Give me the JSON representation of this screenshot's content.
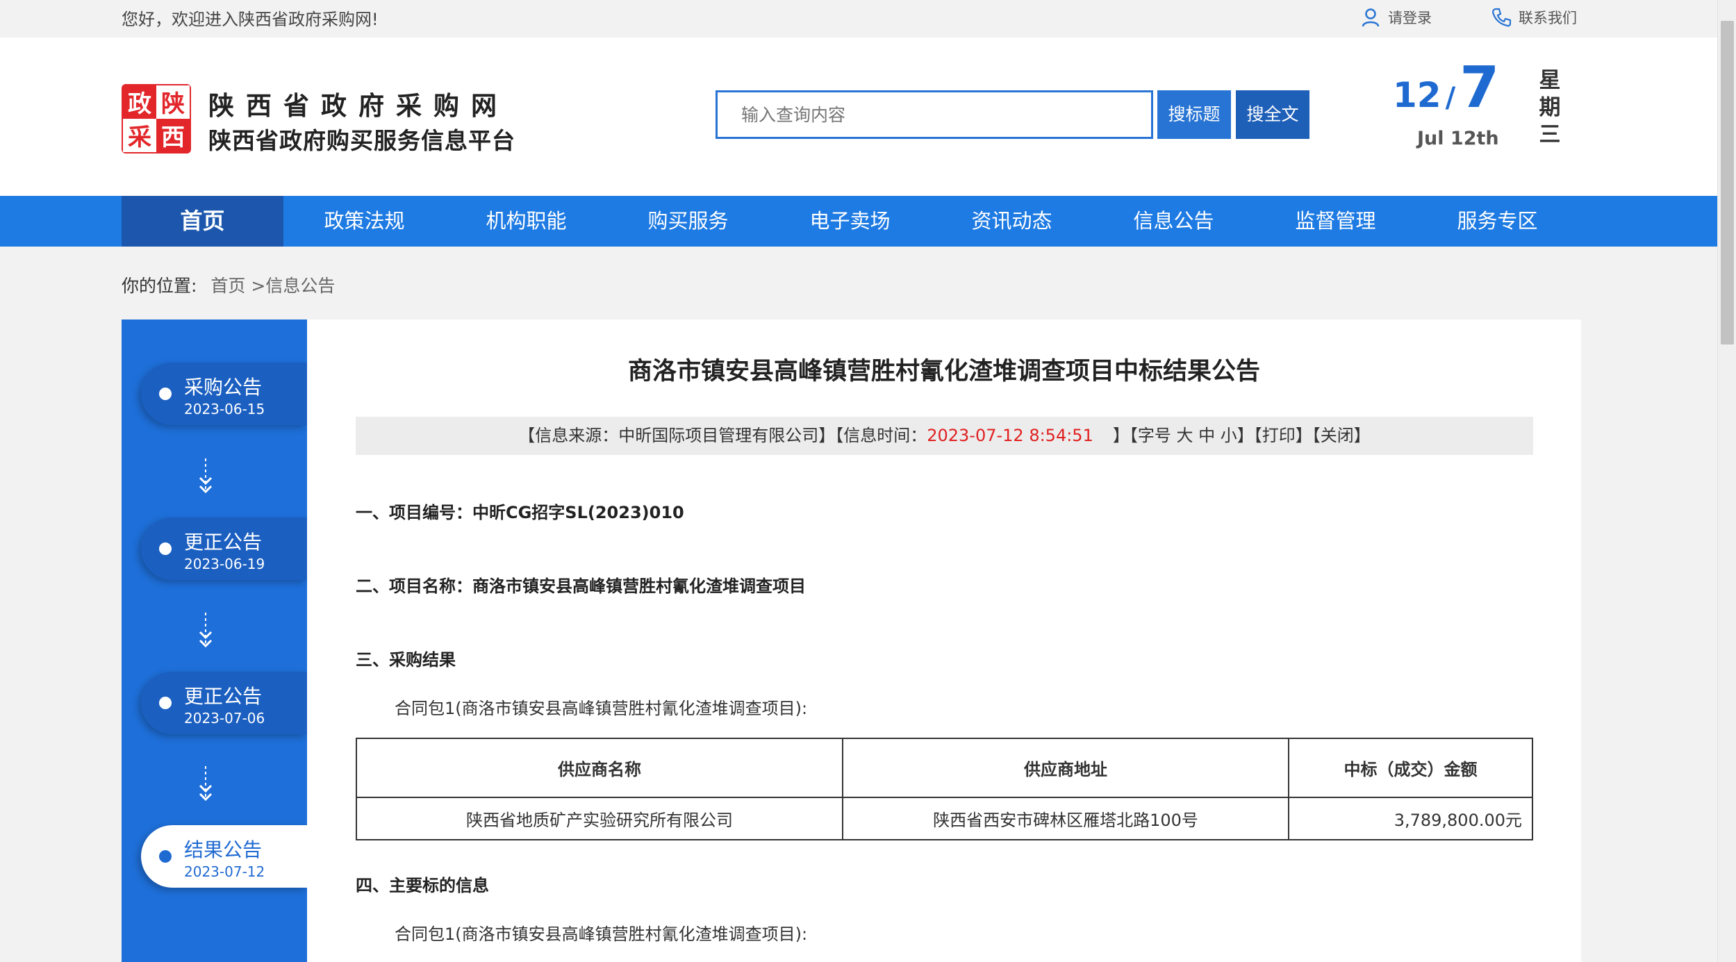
{
  "topbar": {
    "welcome": "您好，欢迎进入陕西省政府采购网!",
    "login": "请登录",
    "contact": "联系我们"
  },
  "header": {
    "logo_chars": [
      "政",
      "陕",
      "采",
      "西"
    ],
    "site_title": "陕西省政府采购网",
    "site_subtitle": "陕西省政府购买服务信息平台",
    "search_placeholder": "输入查询内容",
    "search_title_btn": "搜标题",
    "search_full_btn": "搜全文",
    "date_month": "12",
    "date_slash": "/",
    "date_day": "7",
    "date_en": "Jul 12th",
    "weekday_chars": [
      "星",
      "期",
      "三"
    ]
  },
  "nav": [
    "首页",
    "政策法规",
    "机构职能",
    "购买服务",
    "电子卖场",
    "资讯动态",
    "信息公告",
    "监督管理",
    "服务专区"
  ],
  "breadcrumb": {
    "label": "你的位置:",
    "home": "首页",
    "sep": " >",
    "current": "信息公告"
  },
  "timeline": [
    {
      "title": "采购公告",
      "date": "2023-06-15",
      "active": false
    },
    {
      "title": "更正公告",
      "date": "2023-06-19",
      "active": false
    },
    {
      "title": "更正公告",
      "date": "2023-07-06",
      "active": false
    },
    {
      "title": "结果公告",
      "date": "2023-07-12",
      "active": true
    }
  ],
  "article": {
    "title": "商洛市镇安县高峰镇营胜村氰化渣堆调查项目中标结果公告",
    "source_prefix": "【信息来源：中昕国际项目管理有限公司】【信息时间：",
    "time": "2023-07-12 8:54:51",
    "source_suffix": "】【字号",
    "font_big": "大",
    "font_mid": "中",
    "font_small": "小",
    "bracket_close": "】",
    "print": "【打印】",
    "close": "【关闭】",
    "s1": "一、项目编号：中昕CG招字SL(2023)010",
    "s2": "二、项目名称：商洛市镇安县高峰镇营胜村氰化渣堆调查项目",
    "s3": "三、采购结果",
    "package": "合同包1(商洛市镇安县高峰镇营胜村氰化渣堆调查项目):",
    "table_headers": [
      "供应商名称",
      "供应商地址",
      "中标（成交）金额"
    ],
    "table_rows": [
      [
        "陕西省地质矿产实验研究所有限公司",
        "陕西省西安市碑林区雁塔北路100号",
        "3,789,800.00元"
      ]
    ],
    "s4": "四、主要标的信息",
    "package2": "合同包1(商洛市镇安县高峰镇营胜村氰化渣堆调查项目):"
  },
  "colors": {
    "brand_blue": "#1e7be3",
    "nav_active": "#1c57ad",
    "logo_red": "#e2262a",
    "time_red": "#e02020"
  }
}
